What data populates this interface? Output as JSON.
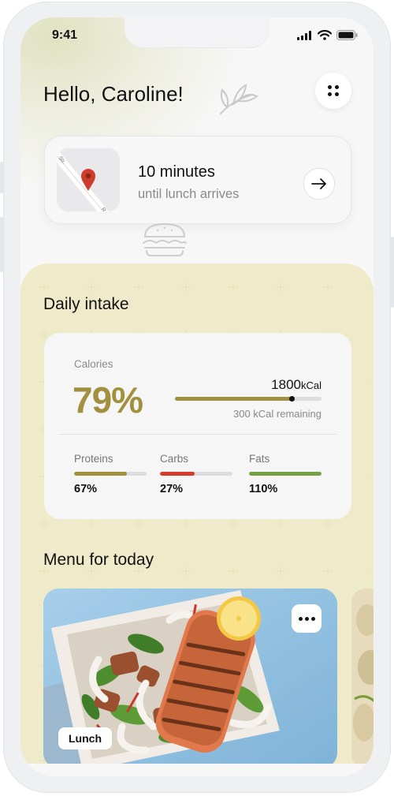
{
  "status_bar": {
    "time": "9:41"
  },
  "header": {
    "greeting": "Hello, Caroline!"
  },
  "delivery": {
    "title": "10 minutes",
    "subtitle": "until lunch arrives",
    "map_street_a": "Str.",
    "map_street_b": "R"
  },
  "intake": {
    "title": "Daily intake",
    "calories_label": "Calories",
    "calories_percent": "79%",
    "calories_progress": 0.8,
    "kcal_amount": "1800",
    "kcal_unit": "kCal",
    "remaining": "300 kCal remaining",
    "macros": [
      {
        "label": "Proteins",
        "value": "67%",
        "progress": 0.73,
        "color": "#a3903e"
      },
      {
        "label": "Carbs",
        "value": "27%",
        "progress": 0.48,
        "color": "#d63b2b"
      },
      {
        "label": "Fats",
        "value": "110%",
        "progress": 1.0,
        "color": "#76a043"
      }
    ]
  },
  "menu": {
    "title": "Menu for today",
    "cards": [
      {
        "tag": "Lunch"
      }
    ]
  },
  "colors": {
    "accent_gold": "#a3903e",
    "panel_bg": "#efebca",
    "carbs_red": "#d63b2b",
    "fats_green": "#76a043"
  }
}
